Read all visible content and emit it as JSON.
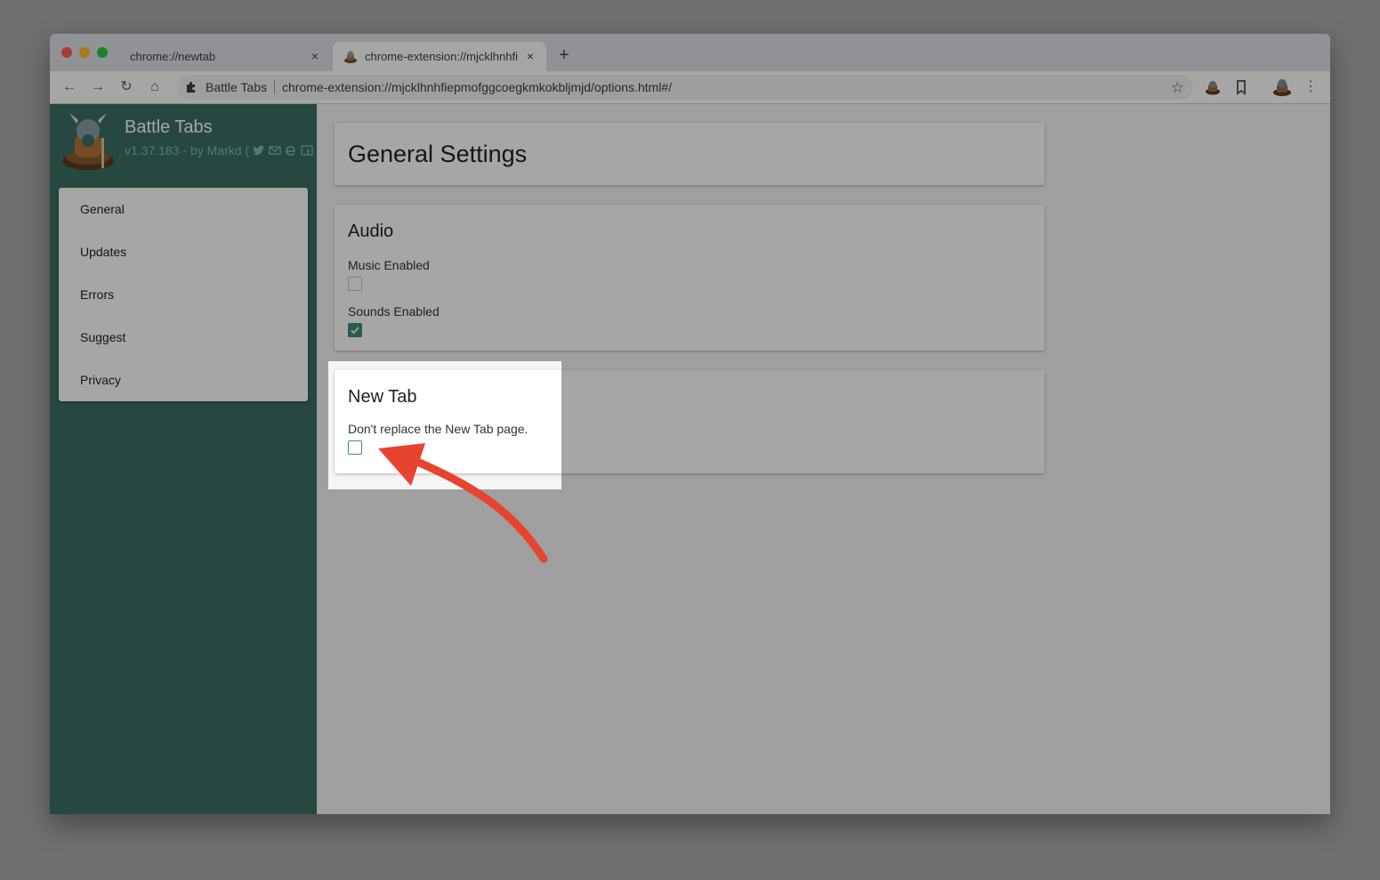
{
  "browser": {
    "tabs": [
      {
        "title": "chrome://newtab",
        "close": "×"
      },
      {
        "title": "chrome-extension://mjcklhnhfiepmofggcoegkmkokbljmjd/options.html#/",
        "close": "×"
      }
    ],
    "new_tab": "+",
    "omnibox": {
      "extension_name": "Battle Tabs",
      "url": "chrome-extension://mjcklhnhfiepmofggcoegkmkokbljmjd/options.html#/"
    },
    "nav": {
      "back": "←",
      "forward": "→",
      "reload": "↻",
      "home": "⌂",
      "star": "☆",
      "menu": "⋮"
    }
  },
  "sidebar": {
    "title": "Battle Tabs",
    "subtitle": "v1.37.183 - by Markd (",
    "menu": [
      {
        "label": "General"
      },
      {
        "label": "Updates"
      },
      {
        "label": "Errors"
      },
      {
        "label": "Suggest"
      },
      {
        "label": "Privacy"
      }
    ]
  },
  "main": {
    "page_title": "General Settings",
    "audio": {
      "title": "Audio",
      "music_label": "Music Enabled",
      "music_checked": false,
      "sounds_label": "Sounds Enabled",
      "sounds_checked": true
    },
    "newtab": {
      "title": "New Tab",
      "replace_label": "Don't replace the New Tab page.",
      "replace_checked": false
    }
  },
  "colors": {
    "sidebar": "#3b6f63",
    "accent": "#3b8f7d",
    "arrow": "#e8432e",
    "dim_overlay": "rgba(0,0,0,0.35)"
  }
}
